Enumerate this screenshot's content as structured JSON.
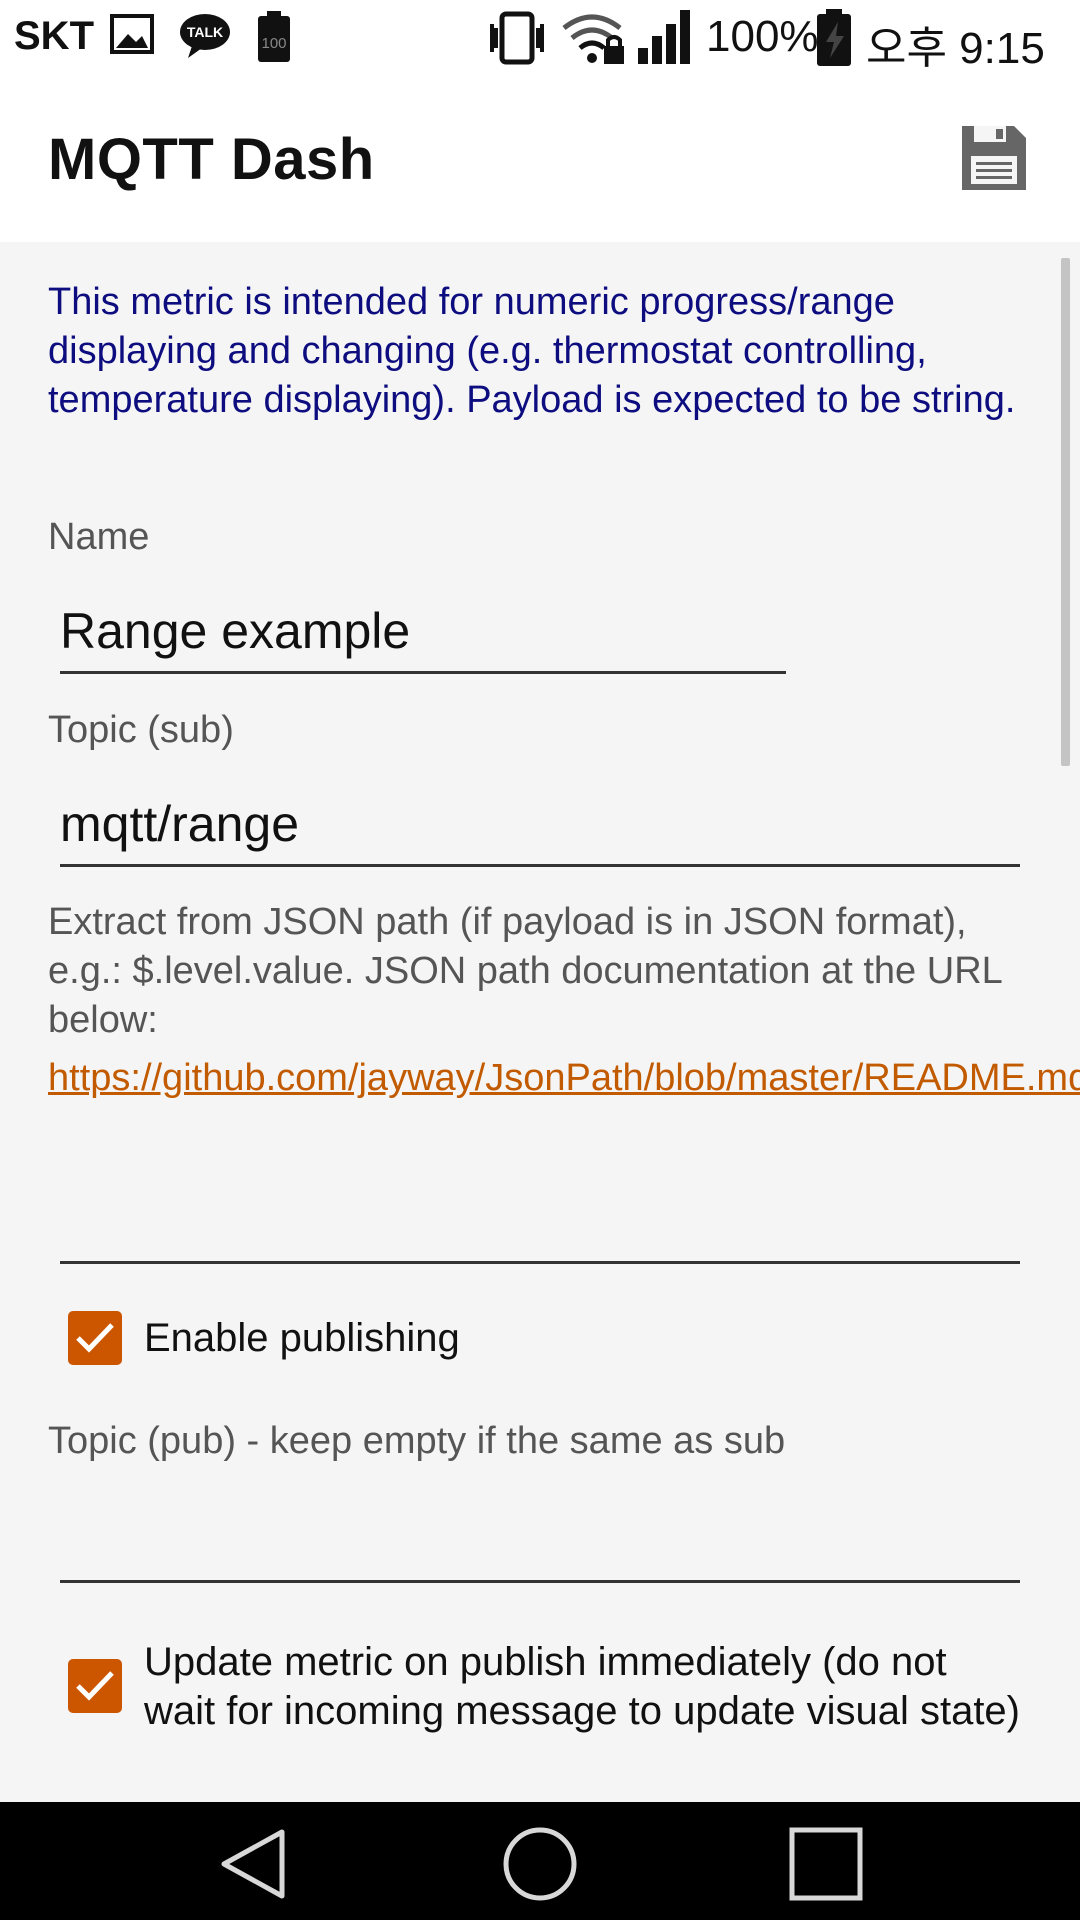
{
  "status_bar": {
    "carrier": "SKT",
    "battery_percent": "100%",
    "time": "오후 9:15",
    "small_battery_label": "100",
    "talk_label": "TALK"
  },
  "app_bar": {
    "title": "MQTT Dash",
    "save_icon": "save-icon"
  },
  "form": {
    "description": "This metric is intended for numeric progress/range displaying and changing (e.g. thermostat controlling, temperature displaying). Payload is expected to be string.",
    "name_label": "Name",
    "name_value": "Range example",
    "topic_sub_label": "Topic (sub)",
    "topic_sub_value": "mqtt/range",
    "json_help": "Extract from JSON path (if payload is in JSON format), e.g.: $.level.value. JSON path documentation at the URL below:",
    "json_link": "https://github.com/jayway/JsonPath/blob/master/README.md",
    "json_path_value": "",
    "enable_publishing_label": "Enable publishing",
    "enable_publishing_checked": true,
    "topic_pub_label": "Topic (pub) - keep empty if the same as sub",
    "topic_pub_value": "",
    "update_immediately_label": "Update metric on publish immediately (do not wait for incoming message to update visual state)",
    "update_immediately_checked": true
  },
  "colors": {
    "accent": "#cc5500",
    "description_text": "#0d0d80",
    "link": "#c25a00",
    "content_bg": "#f5f5f5"
  }
}
